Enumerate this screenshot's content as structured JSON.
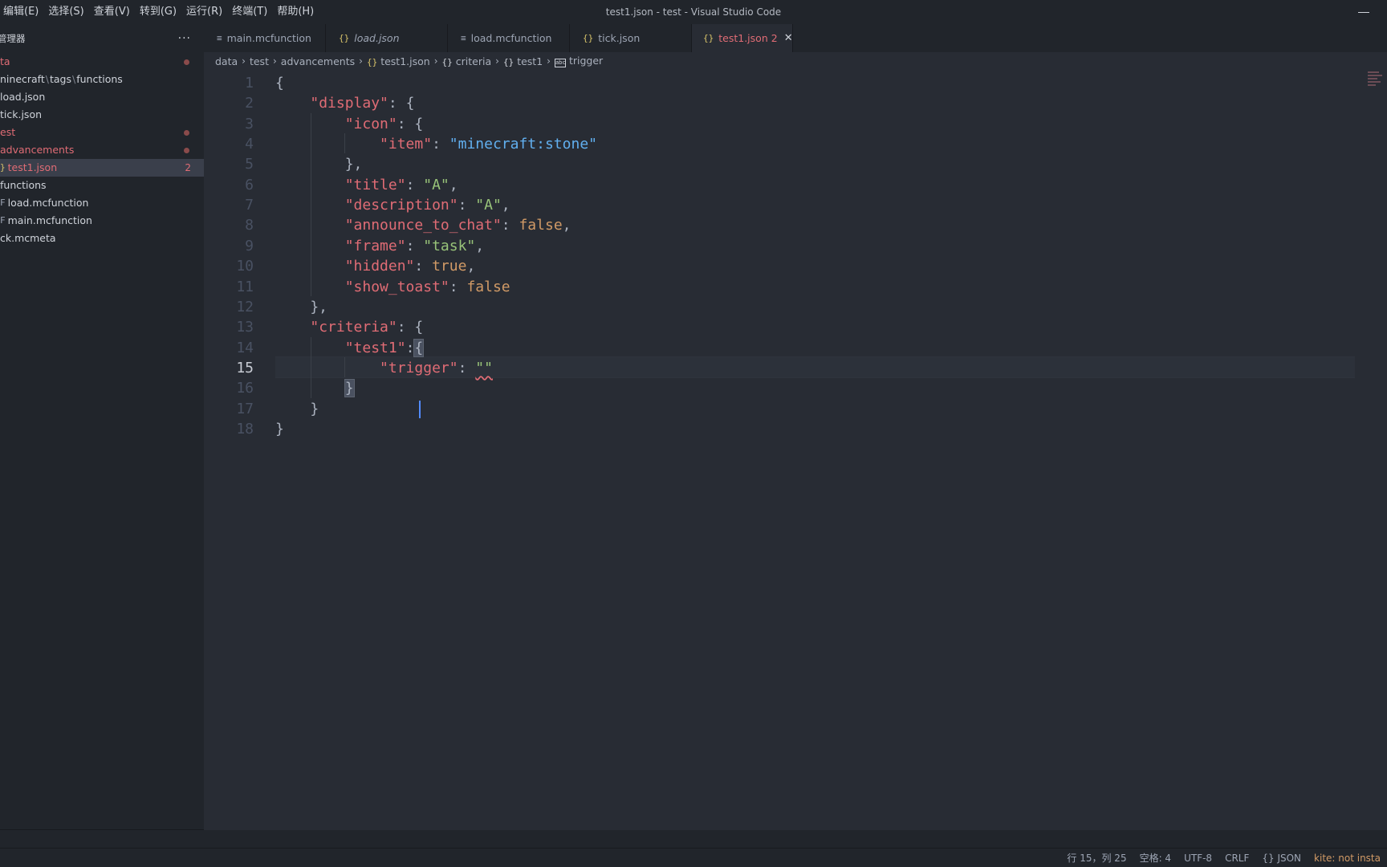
{
  "window": {
    "title": "test1.json - test - Visual Studio Code"
  },
  "menu": [
    "编辑(E)",
    "选择(S)",
    "查看(V)",
    "转到(G)",
    "运行(R)",
    "终端(T)",
    "帮助(H)"
  ],
  "sidebar": {
    "title": "管理器",
    "more": "···",
    "items": [
      {
        "label": "ta",
        "icon": "",
        "git": true,
        "dot": true,
        "badge": ""
      },
      {
        "label": "ninecraft",
        "extra": [
          "tags",
          "functions"
        ],
        "icon": "",
        "git": false,
        "dot": false,
        "badge": ""
      },
      {
        "label": "load.json",
        "icon": "",
        "git": false,
        "dot": false,
        "badge": ""
      },
      {
        "label": "tick.json",
        "icon": "",
        "git": false,
        "dot": false,
        "badge": ""
      },
      {
        "label": "est",
        "icon": "",
        "git": true,
        "dot": true,
        "badge": ""
      },
      {
        "label": "advancements",
        "icon": "",
        "git": true,
        "dot": true,
        "badge": ""
      },
      {
        "label": "test1.json",
        "icon": "}",
        "git": true,
        "dot": false,
        "badge": "2",
        "selected": true
      },
      {
        "label": "functions",
        "icon": "",
        "git": false,
        "dot": false,
        "badge": ""
      },
      {
        "label": "load.mcfunction",
        "icon": "F",
        "git": false,
        "dot": false,
        "badge": ""
      },
      {
        "label": "main.mcfunction",
        "icon": "F",
        "git": false,
        "dot": false,
        "badge": ""
      },
      {
        "label": "ck.mcmeta",
        "icon": "",
        "git": false,
        "dot": false,
        "badge": ""
      }
    ]
  },
  "tabs": [
    {
      "label": "main.mcfunction",
      "icon": "≡",
      "type": "file"
    },
    {
      "label": "load.json",
      "icon": "{}",
      "type": "json",
      "italic": true
    },
    {
      "label": "load.mcfunction",
      "icon": "≡",
      "type": "file"
    },
    {
      "label": "tick.json",
      "icon": "{}",
      "type": "json"
    },
    {
      "label": "test1.json",
      "icon": "{}",
      "type": "json",
      "active": true,
      "badge": "2",
      "close": "✕"
    }
  ],
  "breadcrumb": [
    {
      "label": "data",
      "icon": ""
    },
    {
      "label": "test",
      "icon": ""
    },
    {
      "label": "advancements",
      "icon": ""
    },
    {
      "label": "test1.json",
      "icon": "{}",
      "type": "json"
    },
    {
      "label": "criteria",
      "icon": "{}",
      "type": "obj"
    },
    {
      "label": "test1",
      "icon": "{}",
      "type": "obj"
    },
    {
      "label": "trigger",
      "icon": "abc",
      "type": "str"
    }
  ],
  "editor": {
    "active_line": 15,
    "lines": [
      [
        [
          "p",
          "{"
        ]
      ],
      [
        [
          "p",
          "    "
        ],
        [
          "k",
          "\"display\""
        ],
        [
          "p",
          ": {"
        ]
      ],
      [
        [
          "p",
          "        "
        ],
        [
          "k",
          "\"icon\""
        ],
        [
          "p",
          ": {"
        ]
      ],
      [
        [
          "p",
          "            "
        ],
        [
          "k",
          "\"item\""
        ],
        [
          "p",
          ": "
        ],
        [
          "sv",
          "\"minecraft:stone\""
        ]
      ],
      [
        [
          "p",
          "        },"
        ]
      ],
      [
        [
          "p",
          "        "
        ],
        [
          "k",
          "\"title\""
        ],
        [
          "p",
          ": "
        ],
        [
          "s",
          "\"A\""
        ],
        [
          "p",
          ","
        ]
      ],
      [
        [
          "p",
          "        "
        ],
        [
          "k",
          "\"description\""
        ],
        [
          "p",
          ": "
        ],
        [
          "s",
          "\"A\""
        ],
        [
          "p",
          ","
        ]
      ],
      [
        [
          "p",
          "        "
        ],
        [
          "k",
          "\"announce_to_chat\""
        ],
        [
          "p",
          ": "
        ],
        [
          "b",
          "false"
        ],
        [
          "p",
          ","
        ]
      ],
      [
        [
          "p",
          "        "
        ],
        [
          "k",
          "\"frame\""
        ],
        [
          "p",
          ": "
        ],
        [
          "s",
          "\"task\""
        ],
        [
          "p",
          ","
        ]
      ],
      [
        [
          "p",
          "        "
        ],
        [
          "k",
          "\"hidden\""
        ],
        [
          "p",
          ": "
        ],
        [
          "b",
          "true"
        ],
        [
          "p",
          ","
        ]
      ],
      [
        [
          "p",
          "        "
        ],
        [
          "k",
          "\"show_toast\""
        ],
        [
          "p",
          ": "
        ],
        [
          "b",
          "false"
        ]
      ],
      [
        [
          "p",
          "    },"
        ]
      ],
      [
        [
          "p",
          "    "
        ],
        [
          "k",
          "\"criteria\""
        ],
        [
          "p",
          ": {"
        ]
      ],
      [
        [
          "p",
          "        "
        ],
        [
          "k",
          "\"test1\""
        ],
        [
          "p",
          ":"
        ],
        [
          "m",
          "{"
        ]
      ],
      [
        [
          "p",
          "            "
        ],
        [
          "k",
          "\"trigger\""
        ],
        [
          "p",
          ": "
        ],
        [
          "q",
          "\"\""
        ]
      ],
      [
        [
          "p",
          "        "
        ],
        [
          "m",
          "}"
        ]
      ],
      [
        [
          "p",
          "    }"
        ]
      ],
      [
        [
          "p",
          "}"
        ]
      ]
    ]
  },
  "status": {
    "position": "行 15，列 25",
    "indent": "空格: 4",
    "encoding": "UTF-8",
    "eol": "CRLF",
    "language": "{} JSON",
    "warning": "kite: not insta"
  }
}
